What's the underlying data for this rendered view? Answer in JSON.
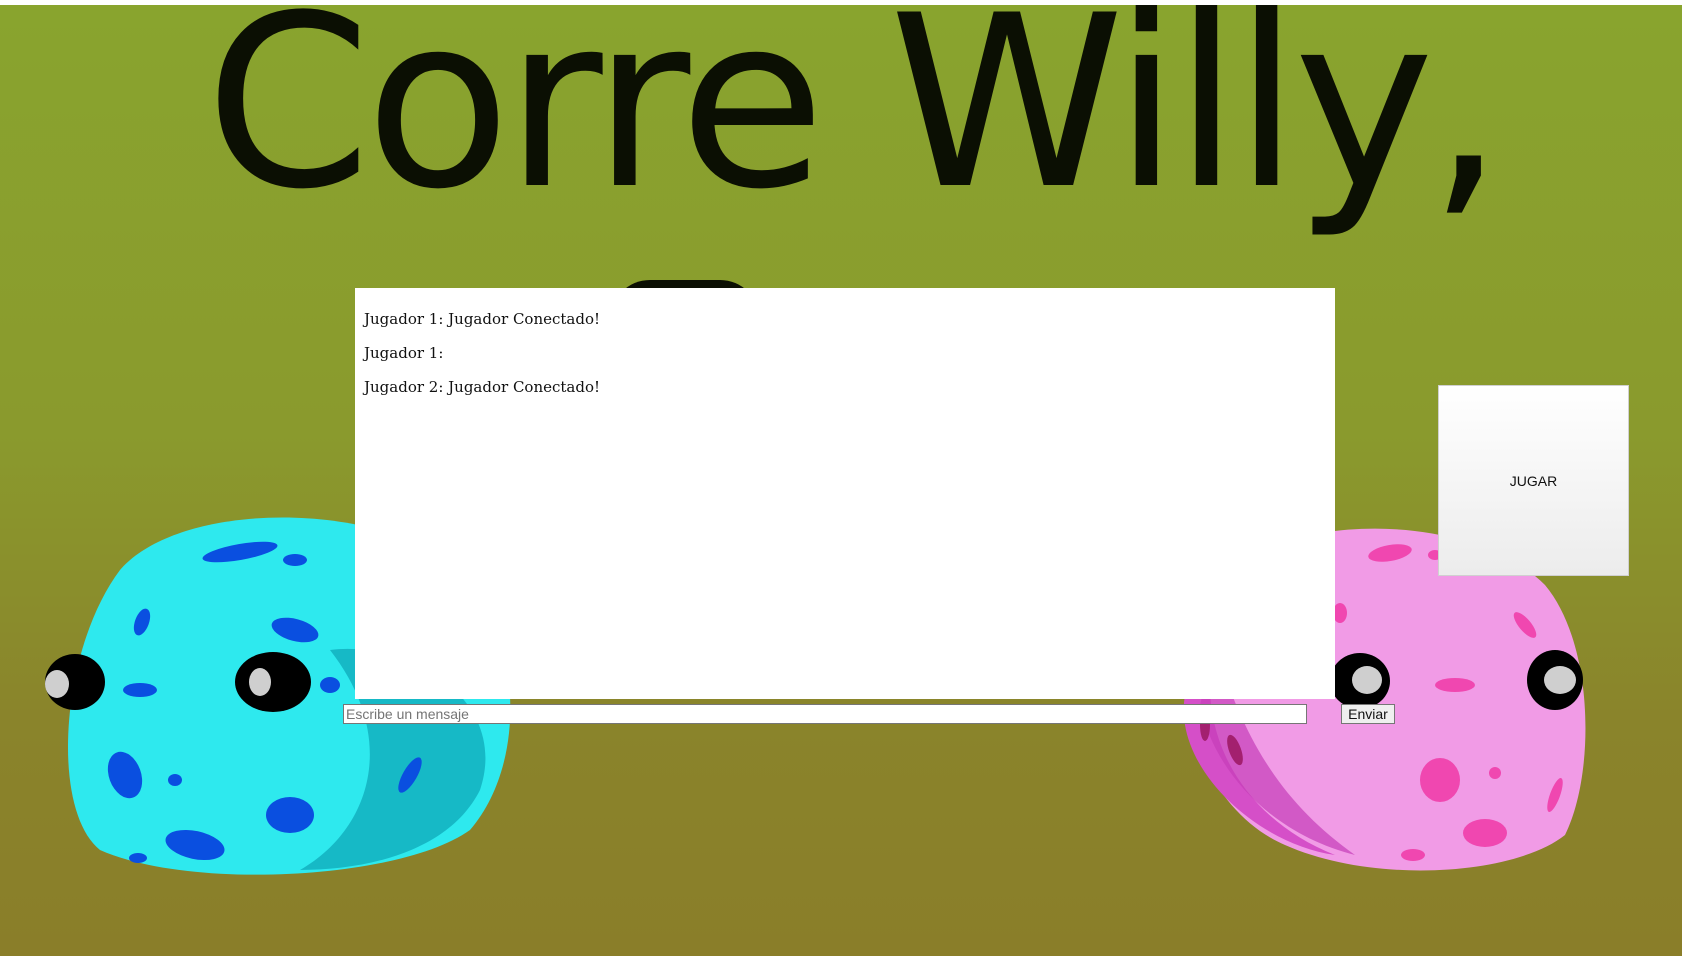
{
  "page": {
    "title": "Corre Willy,"
  },
  "chat": {
    "messages": [
      "Jugador 1: Jugador Conectado!",
      "Jugador 1:",
      "Jugador 2: Jugador Conectado!"
    ],
    "input_placeholder": "Escribe un mensaje",
    "send_label": "Enviar"
  },
  "play": {
    "label": "JUGAR"
  },
  "characters": [
    {
      "name": "blue-blob-icon",
      "color": "#2ee9ee"
    },
    {
      "name": "pink-blob-icon",
      "color": "#f19be6"
    }
  ],
  "colors": {
    "background": "#89a42e",
    "title": "#0b0f03"
  }
}
